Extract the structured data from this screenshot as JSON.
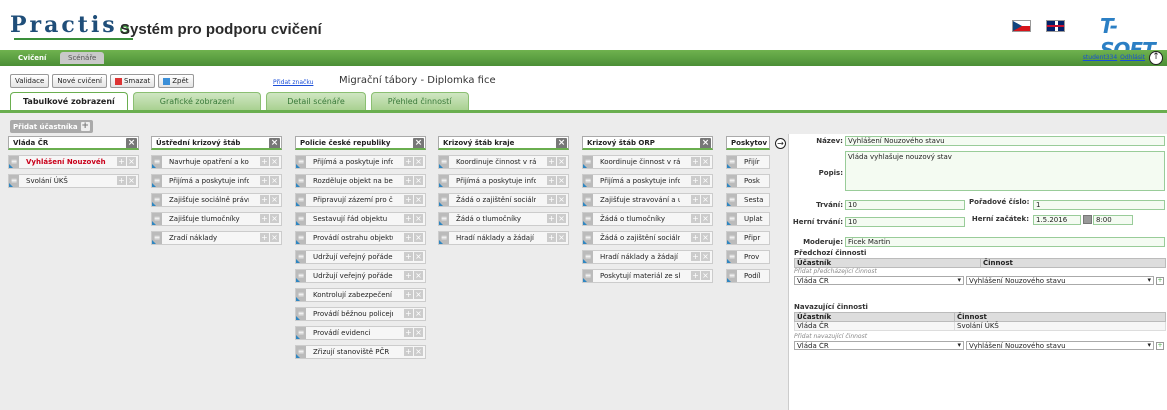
{
  "header": {
    "logo_text": "Practis",
    "subtitle": "Systém pro podporu cvičení",
    "brand": "T-SOFT"
  },
  "nav": {
    "tabs": [
      "Cvičení",
      "Scénáře"
    ],
    "user_link": "student334",
    "logout_link": "Odhlásit"
  },
  "toolbar": {
    "buttons": [
      "Validace",
      "Nové cvičení",
      "Smazat",
      "Zpět"
    ],
    "add_tag_link": "Přidat značku",
    "scenario_title": "Migrační tábory - Diplomka fice"
  },
  "view_tabs": [
    "Tabulkové zobrazení",
    "Grafické zobrazení",
    "Detail scénáře",
    "Přehled činností"
  ],
  "add_participant": "Přidat účastníka",
  "columns": [
    {
      "title": "Vláda ČR",
      "cards": [
        {
          "text": "Vyhlášení Nouzového",
          "highlight": true
        },
        {
          "text": "Svolání ÚKŠ",
          "highlight": false
        }
      ]
    },
    {
      "title": "Ústřední krizový štáb",
      "cards": [
        {
          "text": "Navrhuje opatření a koc"
        },
        {
          "text": "Přijímá a poskytuje info"
        },
        {
          "text": "Zajišťuje sociálně právn"
        },
        {
          "text": "Zajišťuje tlumočníky"
        },
        {
          "text": "Zradí náklady"
        }
      ]
    },
    {
      "title": "Policie české republiky",
      "cards": [
        {
          "text": "Přijímá a poskytuje info"
        },
        {
          "text": "Rozděluje objekt na bez"
        },
        {
          "text": "Připravují zázemí pro čl"
        },
        {
          "text": "Sestavují řád objektu"
        },
        {
          "text": "Provádí ostrahu objektu"
        },
        {
          "text": "Udržují veřejný pořádek"
        },
        {
          "text": "Udržují veřejný pořádek"
        },
        {
          "text": "Kontrolují zabezpečení"
        },
        {
          "text": "Provádí běžnou policejn"
        },
        {
          "text": "Provádí evidenci"
        },
        {
          "text": "Zřizují stanoviště PČR"
        }
      ]
    },
    {
      "title": "Krizový štáb kraje",
      "cards": [
        {
          "text": "Koordinuje činnost v rá"
        },
        {
          "text": "Přijímá a poskytuje info"
        },
        {
          "text": "Žádá o zajištění sociáln"
        },
        {
          "text": "Žádá o tlumočníky"
        },
        {
          "text": "Hradí náklady a žádají o"
        }
      ]
    },
    {
      "title": "Krizový štáb ORP",
      "cards": [
        {
          "text": "Koordinuje činnost v rá"
        },
        {
          "text": "Přijímá a poskytuje info"
        },
        {
          "text": "Zajišťuje stravování a ul"
        },
        {
          "text": "Žádá o tlumočníky"
        },
        {
          "text": "Žádá o zajištění sociáln"
        },
        {
          "text": "Hradí náklady a žádají o"
        },
        {
          "text": "Poskytují materiál ze sk"
        }
      ]
    },
    {
      "title": "Poskytov",
      "cards": [
        {
          "text": "Přijír"
        },
        {
          "text": "Posk"
        },
        {
          "text": "Sesta"
        },
        {
          "text": "Uplat"
        },
        {
          "text": "Připr"
        },
        {
          "text": "Prov"
        },
        {
          "text": "Podíl"
        }
      ]
    }
  ],
  "detail": {
    "name_label": "Název:",
    "name_value": "Vyhlášení Nouzového stavu",
    "desc_label": "Popis:",
    "desc_value": "Vláda vyhlašuje nouzový stav",
    "duration_label": "Trvání:",
    "duration_value": "10",
    "order_label": "Pořadové číslo:",
    "order_value": "1",
    "game_duration_label": "Herní trvání:",
    "game_duration_value": "10",
    "game_start_label": "Herní začátek:",
    "game_start_date": "1.5.2016",
    "game_start_time": "8:00",
    "moderator_label": "Moderuje:",
    "moderator_value": "Ficek Martin",
    "prev_section": "Předchozí činnosti",
    "prev_headers": [
      "Účastník",
      "Činnost"
    ],
    "prev_hint": "Přidat předcházející činnost",
    "prev_select_participant": "Vláda ČR",
    "prev_select_activity": "Vyhlášení Nouzového stavu",
    "next_section": "Navazující činnosti",
    "next_headers": [
      "Účastník",
      "Činnost"
    ],
    "next_rows": [
      [
        "Vláda ČR",
        "Svolání ÚKŠ"
      ]
    ],
    "next_hint": "Přidat navazující činnost",
    "next_select_participant": "Vláda ČR",
    "next_select_activity": "Vyhlášení Nouzového stavu"
  }
}
